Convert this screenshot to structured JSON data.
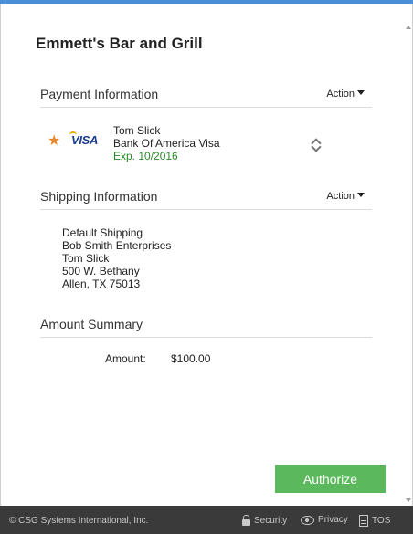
{
  "merchant": {
    "name": "Emmett's Bar and Grill"
  },
  "payment": {
    "title": "Payment Information",
    "action_label": "Action",
    "card": {
      "holder": "Tom Slick",
      "bank": "Bank Of America Visa",
      "expiry": "Exp. 10/2016",
      "brand": "VISA",
      "default_icon": "star-icon"
    }
  },
  "shipping": {
    "title": "Shipping Information",
    "action_label": "Action",
    "address": {
      "label": "Default Shipping",
      "company": "Bob Smith Enterprises",
      "name": "Tom Slick",
      "street": "500 W. Bethany",
      "city_state_zip": "Allen, TX 75013"
    }
  },
  "amount": {
    "title": "Amount Summary",
    "label": "Amount:",
    "value": "$100.00"
  },
  "authorize_label": "Authorize",
  "footer": {
    "copyright": "© CSG Systems International, Inc.",
    "security": "Security",
    "privacy": "Privacy",
    "tos": "TOS"
  },
  "colors": {
    "accent_bar": "#4a8fd6",
    "authorize_button": "#5cb85c",
    "expiry_text": "#2a8a2a",
    "star": "#e8892a",
    "footer_bg": "#3a3a3a"
  }
}
